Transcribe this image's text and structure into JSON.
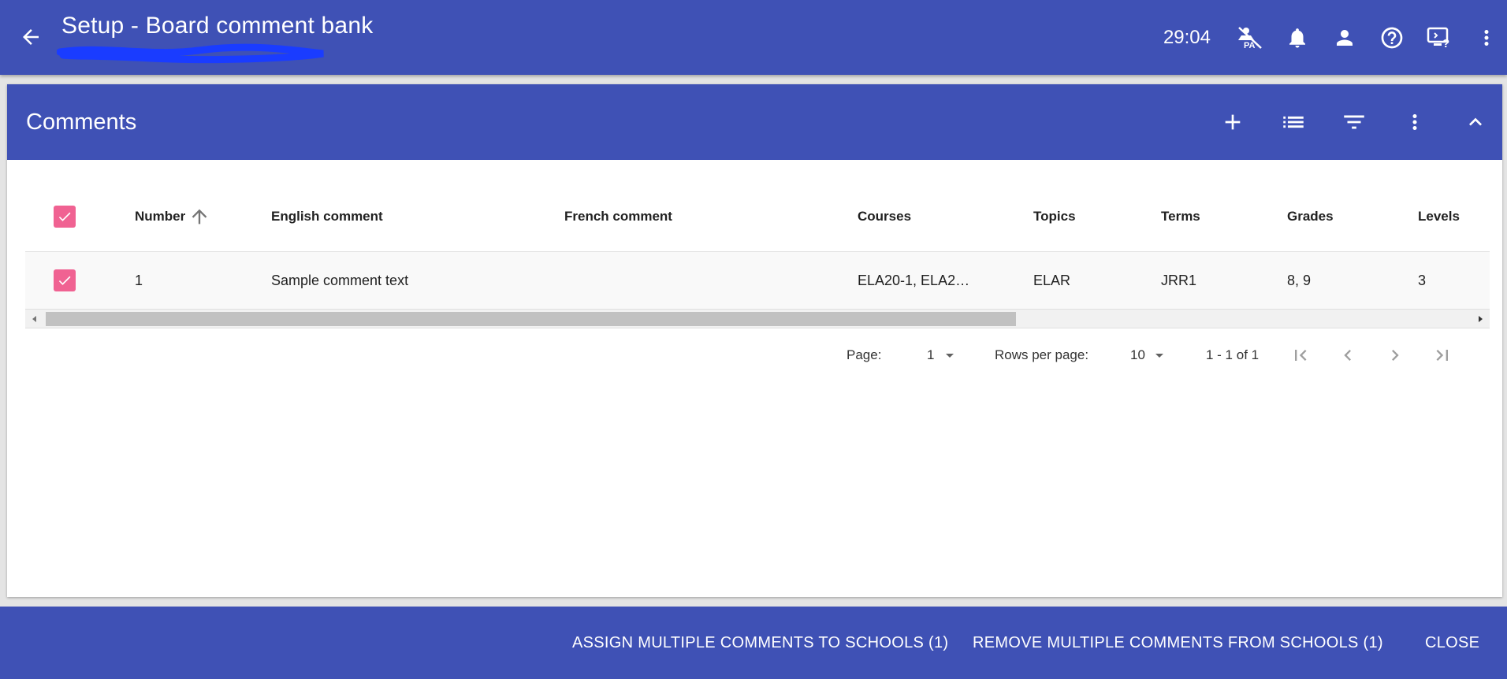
{
  "header": {
    "title": "Setup - Board comment bank",
    "timer": "29:04",
    "icons": [
      "arrow-back-icon",
      "pa-off-icon",
      "bell-icon",
      "person-icon",
      "help-circle-icon",
      "screen-help-icon",
      "more-vert-icon"
    ]
  },
  "card": {
    "title": "Comments",
    "icons": [
      "add-icon",
      "list-icon",
      "filter-icon",
      "more-vert-icon",
      "chevron-up-icon"
    ]
  },
  "table": {
    "columns": [
      "Number",
      "English comment",
      "French comment",
      "Courses",
      "Topics",
      "Terms",
      "Grades",
      "Levels"
    ],
    "sort": {
      "column": "Number",
      "direction": "asc"
    },
    "rows": [
      {
        "selected": true,
        "number": "1",
        "english": "Sample comment text",
        "french": "",
        "courses": "ELA20-1, ELA2…",
        "topics": "ELAR",
        "terms": "JRR1",
        "grades": "8, 9",
        "levels": "3"
      }
    ],
    "scroll_position": 0.0
  },
  "pager": {
    "page_label": "Page:",
    "page_value": "1",
    "rows_label": "Rows per page:",
    "rows_value": "10",
    "range": "1 - 1 of 1"
  },
  "footer": {
    "assign_label": "ASSIGN MULTIPLE COMMENTS TO SCHOOLS (1)",
    "remove_label": "REMOVE MULTIPLE COMMENTS FROM SCHOOLS (1)",
    "close_label": "CLOSE"
  },
  "colors": {
    "primary": "#3f51b5",
    "checkbox": "#f06292",
    "scribble": "#1a3cff"
  }
}
